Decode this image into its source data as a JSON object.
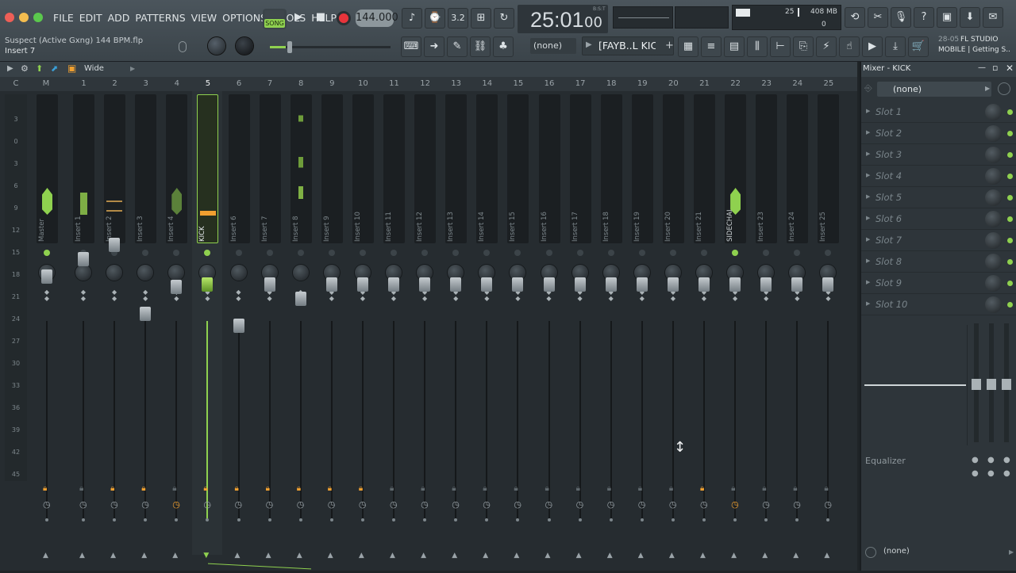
{
  "menu": [
    "FILE",
    "EDIT",
    "ADD",
    "PATTERNS",
    "VIEW",
    "OPTIONS",
    "TOOLS",
    "HELP"
  ],
  "transport": {
    "mode": "SONG",
    "tempo": "144.000",
    "time": "25:01",
    "ticks": "00",
    "bst": "B:S:T"
  },
  "resources": {
    "cpu": "25",
    "memory": "408 MB",
    "polyphony": "0"
  },
  "project": {
    "file": "Suspect (Active Gxng) 144 BPM.flp",
    "hint": "Insert 7"
  },
  "toolbar": {
    "preset": "(none)",
    "pattern": "[FAYB..L KICK"
  },
  "news": {
    "date": "28-05",
    "title": "FL STUDIO",
    "subtitle": "MOBILE | Getting S..."
  },
  "mixer": {
    "view": "Wide",
    "numbers": [
      "C",
      "M",
      "1",
      "2",
      "3",
      "4",
      "5",
      "6",
      "7",
      "8",
      "9",
      "10",
      "11",
      "12",
      "13",
      "14",
      "15",
      "16",
      "17",
      "18",
      "19",
      "20",
      "21",
      "22",
      "23",
      "24",
      "25"
    ],
    "labels": [
      "Master",
      "Insert 1",
      "Insert 2",
      "Insert 3",
      "Insert 4",
      "KICK",
      "Insert 6",
      "Insert 7",
      "Insert 8",
      "Insert 9",
      "Insert 10",
      "Insert 11",
      "Insert 12",
      "Insert 13",
      "Insert 14",
      "Insert 15",
      "Insert 16",
      "Insert 17",
      "Insert 18",
      "Insert 19",
      "Insert 20",
      "Insert 21",
      "SIDECHAIN",
      "Insert 23",
      "Insert 24",
      "Insert 25"
    ],
    "db_scale": [
      "3",
      "0",
      "3",
      "6",
      "9",
      "12",
      "15",
      "18",
      "21",
      "24",
      "27",
      "30",
      "33",
      "36",
      "39",
      "42",
      "45"
    ]
  },
  "panel": {
    "title": "Mixer - KICK",
    "input": "(none)",
    "slots": [
      "Slot 1",
      "Slot 2",
      "Slot 3",
      "Slot 4",
      "Slot 5",
      "Slot 6",
      "Slot 7",
      "Slot 8",
      "Slot 9",
      "Slot 10"
    ],
    "eq_label": "Equalizer",
    "output": "(none)"
  },
  "colors": {
    "accent": "#8fd14f",
    "orange": "#f0a030",
    "selected": "#6d9a30"
  }
}
